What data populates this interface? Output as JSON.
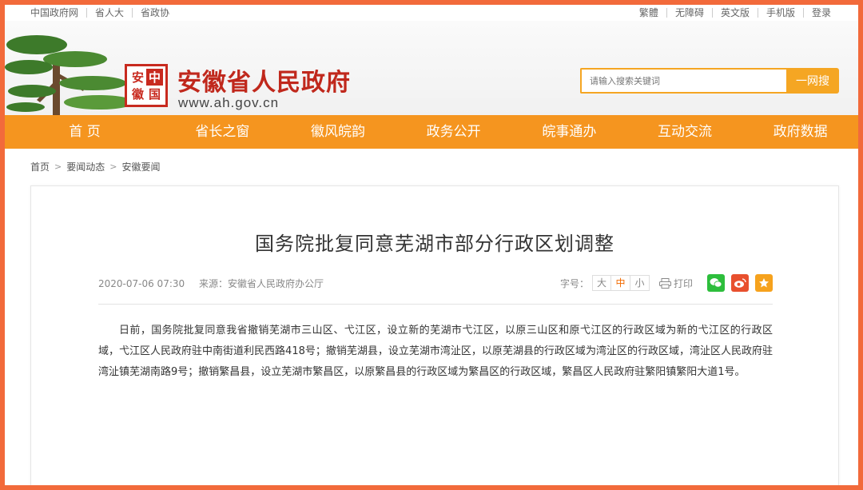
{
  "topbar": {
    "left_links": [
      "中国政府网",
      "省人大",
      "省政协"
    ],
    "right_links": [
      "繁體",
      "无障碍",
      "英文版",
      "手机版",
      "登录"
    ]
  },
  "header": {
    "seal_chars": [
      "安",
      "中",
      "徽",
      "国"
    ],
    "title": "安徽省人民政府",
    "domain": "www.ah.gov.cn"
  },
  "search": {
    "placeholder": "请输入搜索关键词",
    "button_label": "一网搜"
  },
  "nav": {
    "items": [
      "首 页",
      "省长之窗",
      "徽风皖韵",
      "政务公开",
      "皖事通办",
      "互动交流",
      "政府数据"
    ]
  },
  "breadcrumb": {
    "items": [
      "首页",
      "要闻动态",
      "安徽要闻"
    ],
    "separator": ">"
  },
  "article": {
    "title": "国务院批复同意芜湖市部分行政区划调整",
    "datetime": "2020-07-06 07:30",
    "source": "来源：安徽省人民政府办公厅",
    "fontsize_label": "字号：",
    "fontsize_options": [
      "大",
      "中",
      "小"
    ],
    "fontsize_selected": "中",
    "print_label": "打印",
    "body": "日前，国务院批复同意我省撤销芜湖市三山区、弋江区，设立新的芜湖市弋江区，以原三山区和原弋江区的行政区域为新的弋江区的行政区域，弋江区人民政府驻中南街道利民西路418号；撤销芜湖县，设立芜湖市湾沚区，以原芜湖县的行政区域为湾沚区的行政区域，湾沚区人民政府驻湾沚镇芜湖南路9号；撤销繁昌县，设立芜湖市繁昌区，以原繁昌县的行政区域为繁昌区的行政区域，繁昌区人民政府驻繁阳镇繁阳大道1号。"
  },
  "colors": {
    "frame": "#f26a3b",
    "nav_bg": "#f5951f",
    "title_red": "#c0281c",
    "search_accent": "#f5a623"
  }
}
